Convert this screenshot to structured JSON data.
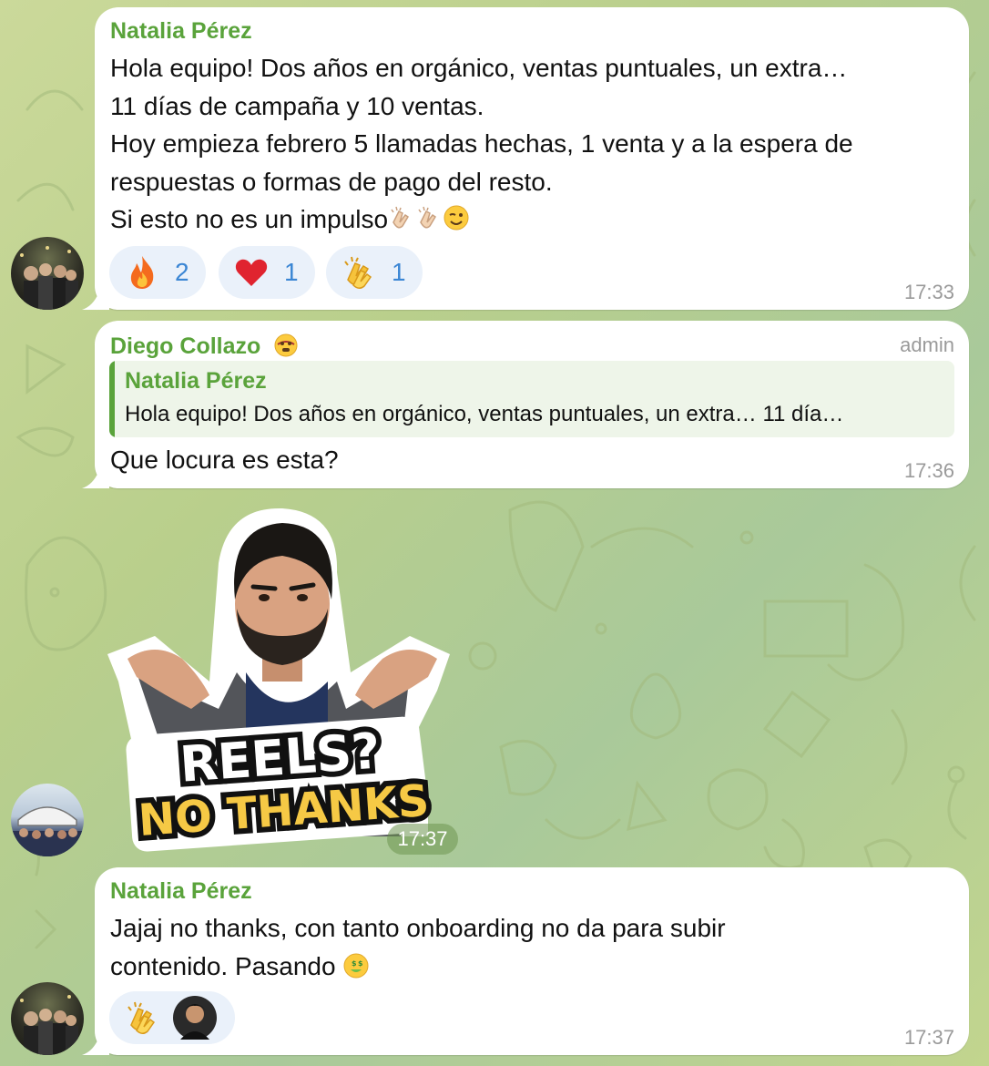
{
  "messages": [
    {
      "sender": "Natalia Pérez",
      "lines": [
        "Hola equipo! Dos años en orgánico, ventas puntuales, un extra…",
        "11 días de campaña y 10 ventas.",
        "Hoy empieza febrero 5 llamadas hechas, 1 venta y a la espera de",
        "respuestas o formas de pago del resto.",
        "Si esto no es un impulso"
      ],
      "reactions": [
        {
          "emoji": "fire-emoji",
          "count": "2"
        },
        {
          "emoji": "heart-emoji",
          "count": "1"
        },
        {
          "emoji": "clap-emoji",
          "count": "1"
        }
      ],
      "time": "17:33"
    },
    {
      "sender": "Diego Collazo",
      "role": "admin",
      "reply": {
        "sender": "Natalia Pérez",
        "text": "Hola equipo! Dos años en orgánico, ventas puntuales, un extra… 11 día…"
      },
      "text": "Que locura es esta?",
      "time": "17:36"
    },
    {
      "sticker": {
        "line1": "REELS?",
        "line2": "NO THANKS"
      },
      "time": "17:37"
    },
    {
      "sender": "Natalia Pérez",
      "lines": [
        "Jajaj no thanks, con tanto onboarding no da para subir",
        "contenido. Pasando"
      ],
      "time": "17:37"
    }
  ],
  "colors": {
    "sender": "#5aa33b",
    "reaction_bg": "#eaf1fa",
    "reaction_count": "#3b86d4",
    "time": "#9a9a9a"
  }
}
